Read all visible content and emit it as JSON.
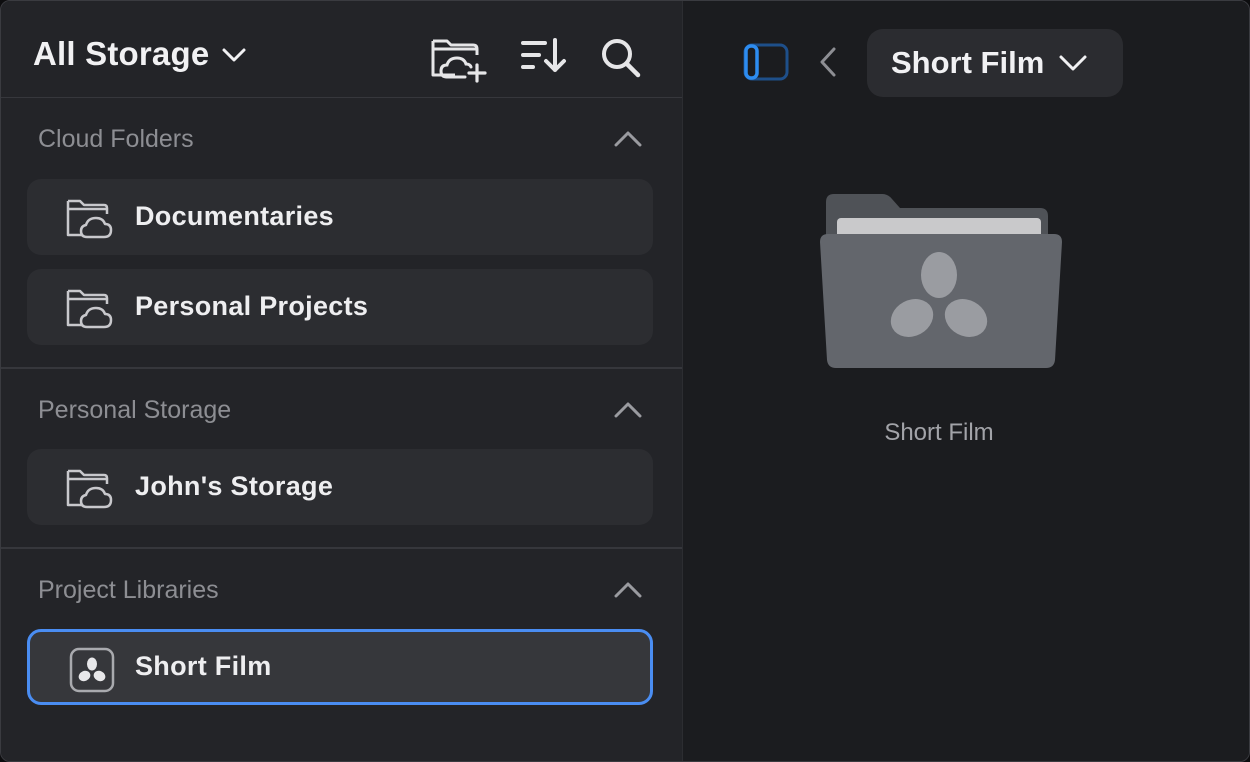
{
  "sidebar": {
    "storage_title": "All Storage",
    "header_icons": [
      "new-cloud-folder-icon",
      "sort-icon",
      "search-icon"
    ],
    "sections": [
      {
        "title": "Cloud Folders",
        "items": [
          {
            "label": "Documentaries",
            "icon": "cloud-folder-icon"
          },
          {
            "label": "Personal Projects",
            "icon": "cloud-folder-icon"
          }
        ]
      },
      {
        "title": "Personal Storage",
        "items": [
          {
            "label": "John's Storage",
            "icon": "cloud-folder-icon"
          }
        ]
      },
      {
        "title": "Project Libraries",
        "items": [
          {
            "label": "Short Film",
            "icon": "resolve-library-icon",
            "selected": true
          }
        ]
      }
    ]
  },
  "main": {
    "breadcrumb": "Short Film",
    "folder": {
      "label": "Short Film",
      "icon": "resolve-folder-icon"
    }
  },
  "colors": {
    "accent": "#4a8df2",
    "sidebar_bg": "#232428",
    "main_bg": "#1b1c1f",
    "item_bg": "#2c2d31",
    "section_text": "#8d8e93"
  }
}
